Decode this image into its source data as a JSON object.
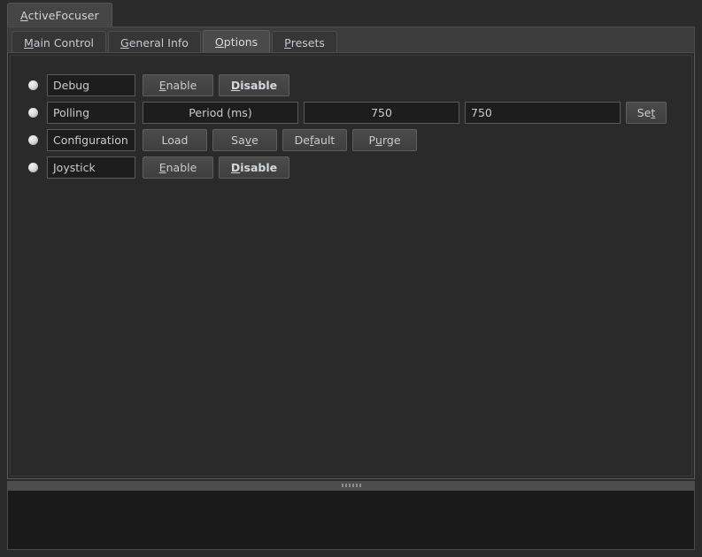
{
  "window": {
    "tab_label": "ActiveFocuser",
    "tab_mnemonic": "A",
    "tab_rest": "ctiveFocuser"
  },
  "tabbar": {
    "tabs": [
      {
        "label": "Main Control",
        "mnemonic": "M",
        "rest": "ain Control",
        "selected": false
      },
      {
        "label": "General Info",
        "mnemonic": "G",
        "rest": "eneral Info",
        "selected": false
      },
      {
        "label": "Options",
        "mnemonic": "O",
        "rest": "ptions",
        "selected": true
      },
      {
        "label": "Presets",
        "mnemonic": "P",
        "rest": "resets",
        "selected": false
      }
    ]
  },
  "options": {
    "rows": {
      "debug": {
        "indicator": "led-off",
        "label": "Debug",
        "enable": {
          "label": "Enable",
          "mnemonic": "E",
          "pre": "",
          "rest": "nable"
        },
        "disable": {
          "label": "Disable",
          "mnemonic": "D",
          "pre": "",
          "rest": "isable"
        }
      },
      "polling": {
        "indicator": "led-off",
        "label": "Polling",
        "period_label": "Period (ms)",
        "period_current": "750",
        "period_input_value": "750",
        "period_input_placeholder": "",
        "set": {
          "label": "Set",
          "pre": "Se",
          "mnemonic": "t",
          "rest": ""
        }
      },
      "configuration": {
        "indicator": "led-off",
        "label": "Configuration",
        "load": {
          "label": "Load",
          "pre": "Load",
          "mnemonic": "",
          "rest": ""
        },
        "save": {
          "label": "Save",
          "pre": "Sa",
          "mnemonic": "v",
          "rest": "e"
        },
        "default": {
          "label": "Default",
          "pre": "De",
          "mnemonic": "f",
          "rest": "ault"
        },
        "purge": {
          "label": "Purge",
          "pre": "P",
          "mnemonic": "u",
          "rest": "rge"
        }
      },
      "joystick": {
        "indicator": "led-off",
        "label": "Joystick",
        "enable": {
          "label": "Enable",
          "mnemonic": "E",
          "pre": "",
          "rest": "nable"
        },
        "disable": {
          "label": "Disable",
          "mnemonic": "D",
          "pre": "",
          "rest": "isable"
        }
      }
    }
  },
  "log": {
    "text": ""
  },
  "colors": {
    "window_bg": "#2b2b2b",
    "panel_bg": "#2a2a2a",
    "field_bg": "#1d1d1d",
    "button_bg": "#454545",
    "text": "#c7ccd3",
    "tab_selected_bg": "#4a4a4a",
    "led_on": "#dcdcdc",
    "log_bg": "#1a1a1a"
  }
}
